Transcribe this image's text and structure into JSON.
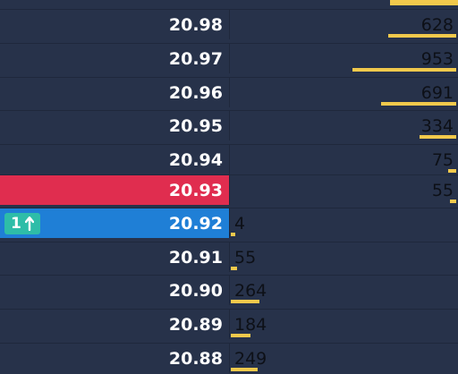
{
  "ladder": {
    "ask_rows": [
      {
        "price": "20.98",
        "qty": "628"
      },
      {
        "price": "20.97",
        "qty": "953"
      },
      {
        "price": "20.96",
        "qty": "691"
      },
      {
        "price": "20.95",
        "qty": "334"
      },
      {
        "price": "20.94",
        "qty": "75"
      },
      {
        "price": "20.93",
        "qty": "55"
      }
    ],
    "bid_rows": [
      {
        "price": "20.92",
        "qty": "4"
      },
      {
        "price": "20.91",
        "qty": "55"
      },
      {
        "price": "20.90",
        "qty": "264"
      },
      {
        "price": "20.89",
        "qty": "184"
      },
      {
        "price": "20.88",
        "qty": "249"
      }
    ],
    "order_badge": {
      "count": "1",
      "icon": "arrow-up-icon"
    },
    "colors": {
      "background": "#27324a",
      "best_ask": "#e02d4f",
      "best_bid": "#1f7fd6",
      "volume_bar": "#f2c94c",
      "badge": "#2ebda8"
    }
  }
}
